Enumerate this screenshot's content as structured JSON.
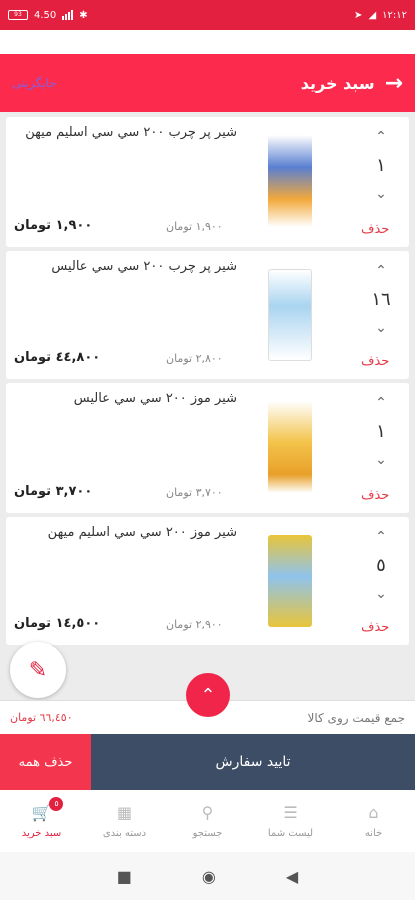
{
  "status_bar": {
    "time": "۱۲:۱۲",
    "battery": "93",
    "network": "4.50"
  },
  "header": {
    "title": "سبد خرید",
    "back_icon": "arrow-right-icon",
    "replace_label": "جایگزینی"
  },
  "cart_items": [
    {
      "name": "شير پر چرب ٢٠٠ سي سي اسليم ميهن",
      "qty": "١",
      "unit_price": "١,٩٠٠ تومان",
      "total": "١,٩٠٠ تومان",
      "delete_label": "حذف",
      "img_color": "#5a7fd1"
    },
    {
      "name": "شير پر چرب ٢٠٠ سي سي عاليس",
      "qty": "١٦",
      "unit_price": "٢,٨٠٠ تومان",
      "total": "٤٤,٨٠٠ تومان",
      "delete_label": "حذف",
      "img_color": "#a9d4f0"
    },
    {
      "name": "شير موز ٢٠٠ سي سي عاليس",
      "qty": "١",
      "unit_price": "٣,٧٠٠ تومان",
      "total": "٣,٧٠٠ تومان",
      "delete_label": "حذف",
      "img_color": "#f3c34a"
    },
    {
      "name": "شير موز ٢٠٠ سي سي اسليم ميهن",
      "qty": "٥",
      "unit_price": "٢,٩٠٠ تومان",
      "total": "١٤,٥٠٠ تومان",
      "delete_label": "حذف",
      "img_color": "#e8c53a"
    }
  ],
  "summary": {
    "label": "جمع قیمت روی کالا",
    "amount": "٦٦,٤٥٠ تومان"
  },
  "actions": {
    "delete_all": "حذف همه",
    "confirm": "تایید سفارش"
  },
  "tabs": [
    {
      "label": "سبد خرید",
      "icon": "cart-icon",
      "badge": "٥",
      "active": true
    },
    {
      "label": "دسته بندی",
      "icon": "grid-icon",
      "active": false
    },
    {
      "label": "جستجو",
      "icon": "search-icon",
      "active": false
    },
    {
      "label": "لیست شما",
      "icon": "list-icon",
      "active": false
    },
    {
      "label": "خانه",
      "icon": "home-icon",
      "active": false
    }
  ],
  "colors": {
    "accent": "#fc2a4d",
    "dark": "#3d4d66",
    "delete": "#e63946"
  }
}
